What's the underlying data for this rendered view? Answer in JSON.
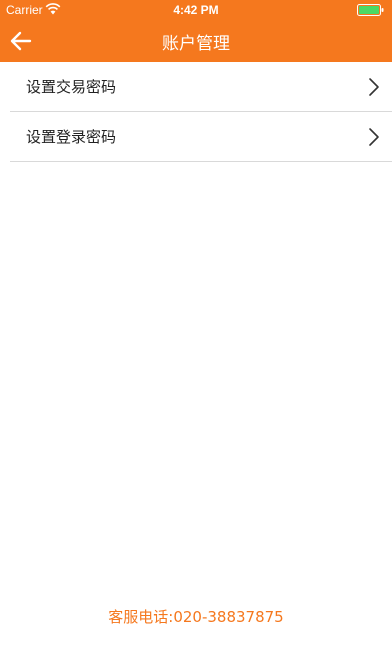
{
  "status_bar": {
    "carrier": "Carrier",
    "time": "4:42 PM",
    "wifi_icon": "wifi-icon",
    "battery_icon": "battery-icon"
  },
  "nav": {
    "title": "账户管理",
    "back_icon": "arrow-left-icon"
  },
  "menu": {
    "items": [
      {
        "label": "设置交易密码",
        "icon": "chevron-right-icon"
      },
      {
        "label": "设置登录密码",
        "icon": "chevron-right-icon"
      }
    ]
  },
  "footer": {
    "phone_text": "客服电话:020-38837875"
  },
  "colors": {
    "accent": "#f5781e",
    "divider": "#d9d9d9",
    "text": "#222222",
    "battery_fill": "#4cd964"
  }
}
